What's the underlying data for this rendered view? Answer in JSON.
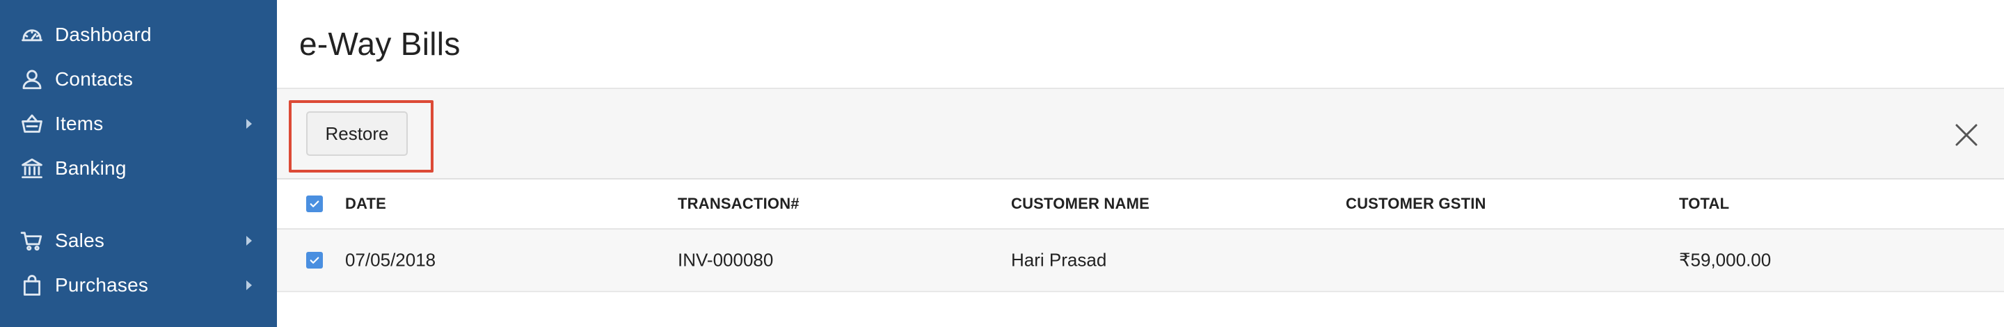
{
  "sidebar": {
    "items": [
      {
        "label": "Dashboard",
        "icon": "speedometer-icon",
        "has_arrow": false
      },
      {
        "label": "Contacts",
        "icon": "person-icon",
        "has_arrow": false
      },
      {
        "label": "Items",
        "icon": "basket-icon",
        "has_arrow": true
      },
      {
        "label": "Banking",
        "icon": "bank-icon",
        "has_arrow": false
      },
      {
        "label": "Sales",
        "icon": "cart-icon",
        "has_arrow": true
      },
      {
        "label": "Purchases",
        "icon": "shopping-bag-icon",
        "has_arrow": true
      }
    ],
    "background_color": "#25578c"
  },
  "header": {
    "title": "e-Way Bills"
  },
  "toolbar": {
    "restore_label": "Restore",
    "highlight_color": "#dc4a36"
  },
  "table": {
    "columns": [
      "DATE",
      "TRANSACTION#",
      "CUSTOMER NAME",
      "CUSTOMER GSTIN",
      "TOTAL"
    ],
    "header_checked": true,
    "rows": [
      {
        "checked": true,
        "date": "07/05/2018",
        "transaction": "INV-000080",
        "customer_name": "Hari Prasad",
        "customer_gstin": "",
        "total": "₹59,000.00"
      }
    ],
    "checkbox_color": "#4a8fe0"
  }
}
